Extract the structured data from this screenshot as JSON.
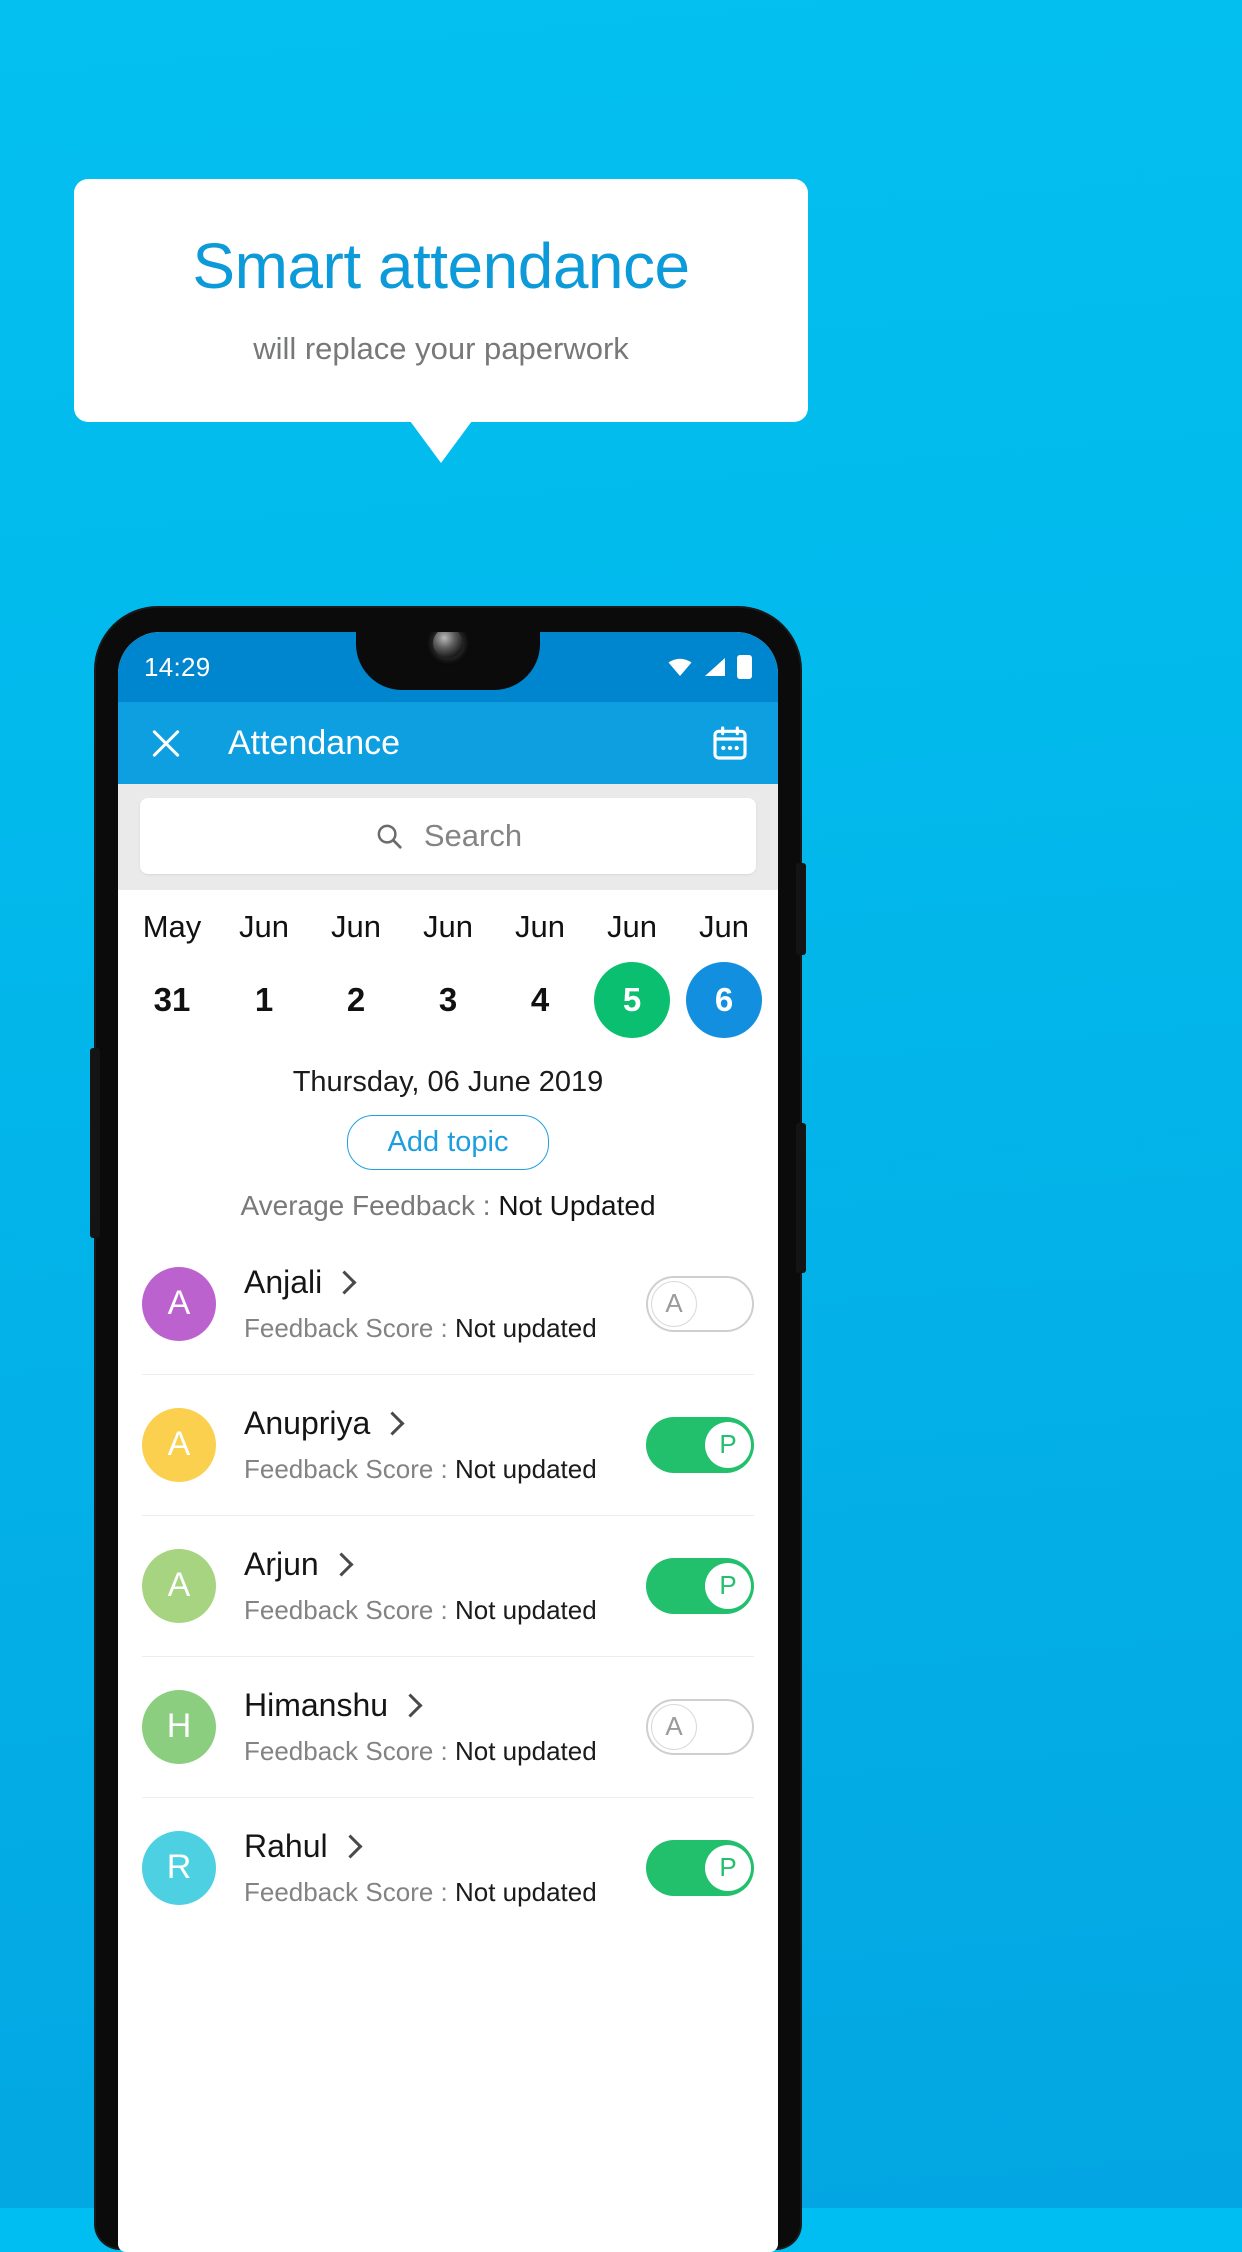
{
  "hero": {
    "title": "Smart attendance",
    "subtitle": "will replace your paperwork",
    "title_color": "#0D9AD9",
    "background_color": "#00BDF2"
  },
  "status_bar": {
    "time": "14:29",
    "icons": [
      "wifi-icon",
      "signal-icon",
      "battery-icon"
    ],
    "background_color": "#0086CF"
  },
  "app_bar": {
    "close_icon": "close-icon",
    "title": "Attendance",
    "calendar_icon": "calendar-icon",
    "background_color": "#0D9FE0"
  },
  "search": {
    "icon": "search-icon",
    "placeholder": "Search",
    "value": ""
  },
  "date_strip": [
    {
      "month": "May",
      "day": "31",
      "state": "normal"
    },
    {
      "month": "Jun",
      "day": "1",
      "state": "normal"
    },
    {
      "month": "Jun",
      "day": "2",
      "state": "normal"
    },
    {
      "month": "Jun",
      "day": "3",
      "state": "normal"
    },
    {
      "month": "Jun",
      "day": "4",
      "state": "normal"
    },
    {
      "month": "Jun",
      "day": "5",
      "state": "green"
    },
    {
      "month": "Jun",
      "day": "6",
      "state": "blue"
    }
  ],
  "selected_date_label": "Thursday, 06 June 2019",
  "add_topic_label": "Add topic",
  "average_feedback": {
    "label": "Average Feedback : ",
    "value": "Not Updated"
  },
  "feedback_label": "Feedback Score : ",
  "students": [
    {
      "initial": "A",
      "avatar_color": "#BC62CF",
      "name": "Anjali",
      "feedback_label": "Feedback Score : ",
      "feedback_value": "Not updated",
      "attendance": "A",
      "toggle_state": "off"
    },
    {
      "initial": "A",
      "avatar_color": "#FBD04F",
      "name": "Anupriya",
      "feedback_label": "Feedback Score : ",
      "feedback_value": "Not updated",
      "attendance": "P",
      "toggle_state": "on"
    },
    {
      "initial": "A",
      "avatar_color": "#A6D480",
      "name": "Arjun",
      "feedback_label": "Feedback Score : ",
      "feedback_value": "Not updated",
      "attendance": "P",
      "toggle_state": "on"
    },
    {
      "initial": "H",
      "avatar_color": "#8CCE7F",
      "name": "Himanshu",
      "feedback_label": "Feedback Score : ",
      "feedback_value": "Not updated",
      "attendance": "A",
      "toggle_state": "off"
    },
    {
      "initial": "R",
      "avatar_color": "#4DD0E1",
      "name": "Rahul",
      "feedback_label": "Feedback Score : ",
      "feedback_value": "Not updated",
      "attendance": "P",
      "toggle_state": "on"
    }
  ],
  "colors": {
    "accent_blue": "#0D9FE0",
    "present_green": "#22C06D",
    "date_green": "#0ABF6F",
    "date_blue": "#1290DF"
  }
}
